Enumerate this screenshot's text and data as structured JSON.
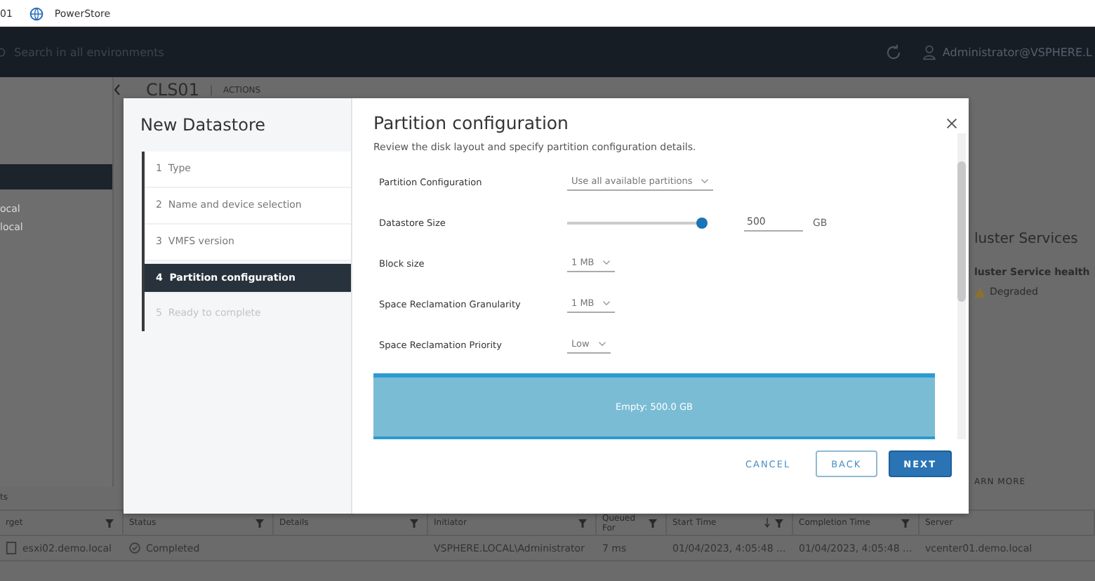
{
  "browser_tab": {
    "prefix": "01",
    "title": "PowerStore"
  },
  "header": {
    "search_placeholder": "Search in all environments",
    "user": "Administrator@VSPHERE.L"
  },
  "breadcrumb": {
    "title": "CLS01",
    "actions": "ACTIONS"
  },
  "nav_items": [
    {
      "label": "ocal"
    },
    {
      "label": "local"
    }
  ],
  "cluster_panel": {
    "title": "luster Services",
    "health_label": "luster Service health",
    "health_status": "Degraded",
    "link": "ARN MORE"
  },
  "tasks": {
    "title": "ts",
    "columns": [
      {
        "label": "rget",
        "filter": true,
        "sorted": false
      },
      {
        "label": "Status",
        "filter": true,
        "sorted": false
      },
      {
        "label": "Details",
        "filter": true,
        "sorted": false
      },
      {
        "label": "Initiator",
        "filter": true,
        "sorted": false
      },
      {
        "label": "Queued For",
        "filter": true,
        "sorted": false
      },
      {
        "label": "Start Time",
        "filter": true,
        "sorted": true
      },
      {
        "label": "Completion Time",
        "filter": true,
        "sorted": false
      },
      {
        "label": "Server",
        "filter": false,
        "sorted": false
      }
    ],
    "rows": [
      {
        "cells": [
          "esxi02.demo.local",
          "Completed",
          "",
          "VSPHERE.LOCAL\\Administrator",
          "7 ms",
          "01/04/2023, 4:05:48 ...",
          "01/04/2023, 4:05:48 ...",
          "vcenter01.demo.local"
        ]
      }
    ]
  },
  "dialog": {
    "title": "New Datastore",
    "steps": [
      {
        "number": "1",
        "label": "Type",
        "selected": false,
        "disabled": false
      },
      {
        "number": "2",
        "label": "Name and device selection",
        "selected": false,
        "disabled": false
      },
      {
        "number": "3",
        "label": "VMFS version",
        "selected": false,
        "disabled": false
      },
      {
        "number": "4",
        "label": "Partition configuration",
        "selected": true,
        "disabled": false
      },
      {
        "number": "5",
        "label": "Ready to complete",
        "selected": false,
        "disabled": true
      }
    ],
    "page_title": "Partition configuration",
    "description": "Review the disk layout and specify partition configuration details.",
    "fields": [
      {
        "kind": "select",
        "label": "Partition Configuration",
        "value": "Use all available partitions"
      },
      {
        "kind": "slider",
        "label": "Datastore Size",
        "level": 1,
        "value": "500",
        "unit": "GB"
      },
      {
        "kind": "select",
        "label": "Block size",
        "value": "1 MB"
      },
      {
        "kind": "select",
        "label": "Space Reclamation Granularity",
        "value": "1 MB"
      },
      {
        "kind": "select",
        "label": "Space Reclamation Priority",
        "value": "Low"
      }
    ],
    "disk_layout": {
      "label": "Empty: 500.0 GB"
    },
    "buttons": [
      {
        "label": "CANCEL",
        "kind": "flat"
      },
      {
        "label": "BACK",
        "kind": "outline"
      },
      {
        "label": "NEXT",
        "kind": "primary"
      }
    ]
  }
}
